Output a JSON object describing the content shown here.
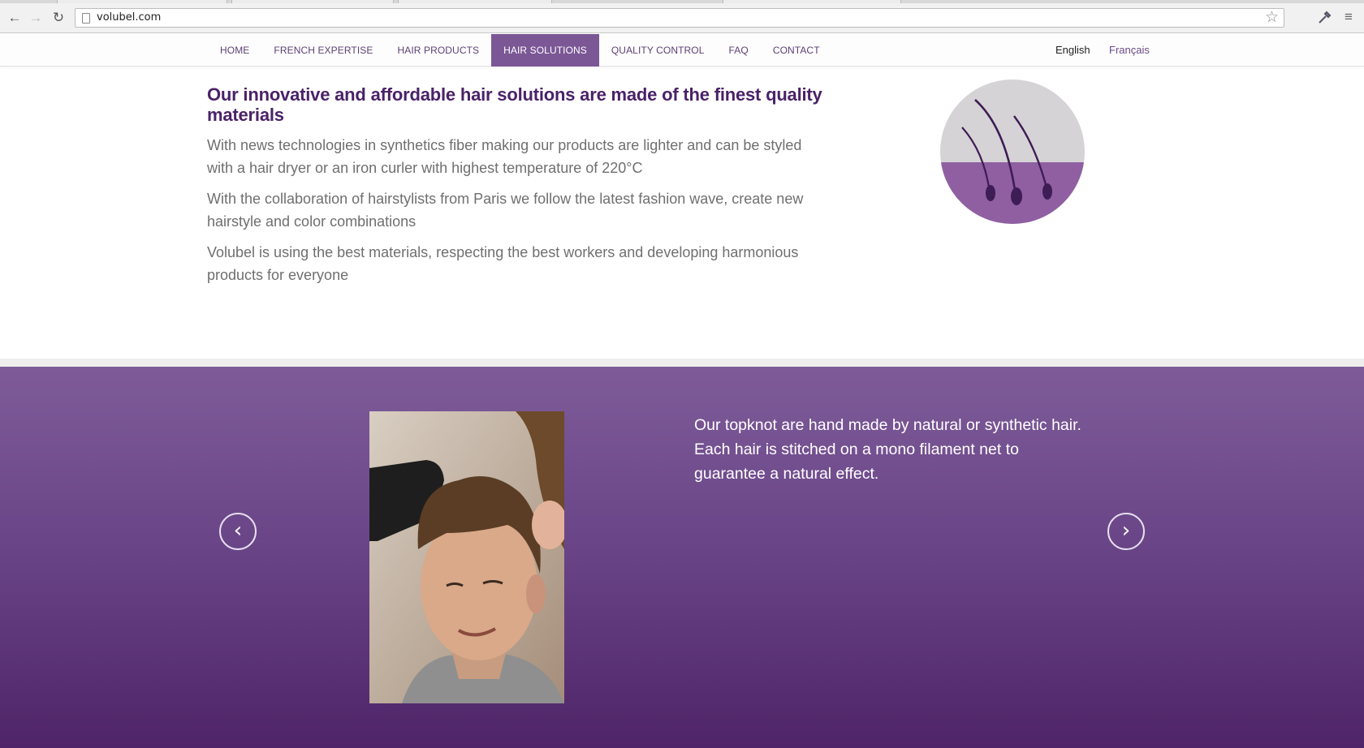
{
  "browser": {
    "url": "volubel.com",
    "back_icon": "←",
    "forward_icon": "→",
    "reload_icon": "↻",
    "star_icon": "☆",
    "menu_icon": "≡"
  },
  "nav": {
    "items": [
      {
        "label": "HOME"
      },
      {
        "label": "FRENCH EXPERTISE"
      },
      {
        "label": "HAIR PRODUCTS"
      },
      {
        "label": "HAIR SOLUTIONS",
        "active": true
      },
      {
        "label": "QUALITY CONTROL"
      },
      {
        "label": "FAQ"
      },
      {
        "label": "CONTACT"
      }
    ],
    "lang_en": "English",
    "lang_fr": "Français"
  },
  "intro": {
    "heading": "Our innovative and affordable hair solutions are made of the finest quality materials",
    "paragraphs": [
      "With news technologies in synthetics fiber making our products are lighter and can be styled with a hair dryer or an iron curler with highest temperature of 220°C",
      "With the collaboration of hairstylists from Paris we follow the latest fashion wave, create new hairstyle and color combinations",
      "Volubel is using the best materials, respecting the best workers and developing harmonious products for everyone"
    ]
  },
  "slider": {
    "text": "Our topknot are hand made by natural or synthetic hair. Each hair is stitched on a mono filament net to guarantee a natural effect.",
    "prev_icon": "‹",
    "next_icon": "›"
  },
  "colors": {
    "brand_purple": "#4a2268",
    "nav_active": "#7b5795",
    "slider_top": "#7e5b98",
    "slider_bottom": "#4f2468"
  }
}
